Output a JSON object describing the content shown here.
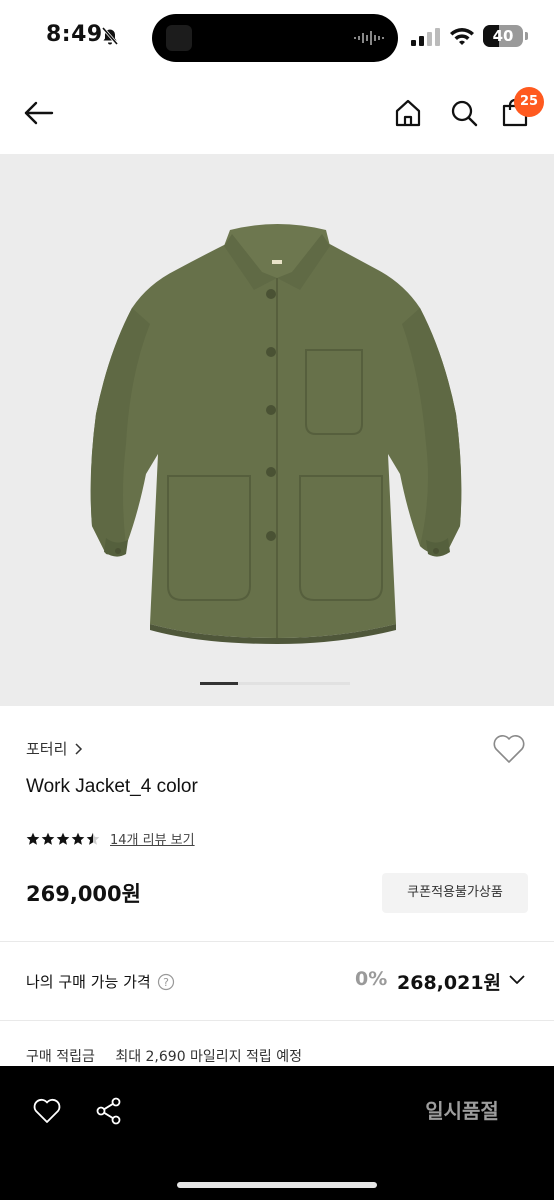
{
  "status_bar": {
    "time": "8:49",
    "battery": "40",
    "battery_level": 0.4
  },
  "nav": {
    "cart_count": "25",
    "badge_color": "#ff5a1f"
  },
  "gallery": {
    "current_index": 1,
    "background": "#ececec",
    "garment_color": "#67714a"
  },
  "product": {
    "brand": "포터리",
    "name": "Work Jacket_4 color",
    "rating": 4.5,
    "review_link": "14개 리뷰 보기",
    "price": "269,000원",
    "coupon_tag": "쿠폰적용불가상품"
  },
  "purchase": {
    "label": "나의 구매 가능 가격",
    "discount": "0%",
    "price": "268,021원"
  },
  "points": {
    "label": "구매 적립금",
    "value": "최대 2,690 마일리지 적립 예정"
  },
  "bottom_bar": {
    "soldout_label": "일시품절"
  }
}
